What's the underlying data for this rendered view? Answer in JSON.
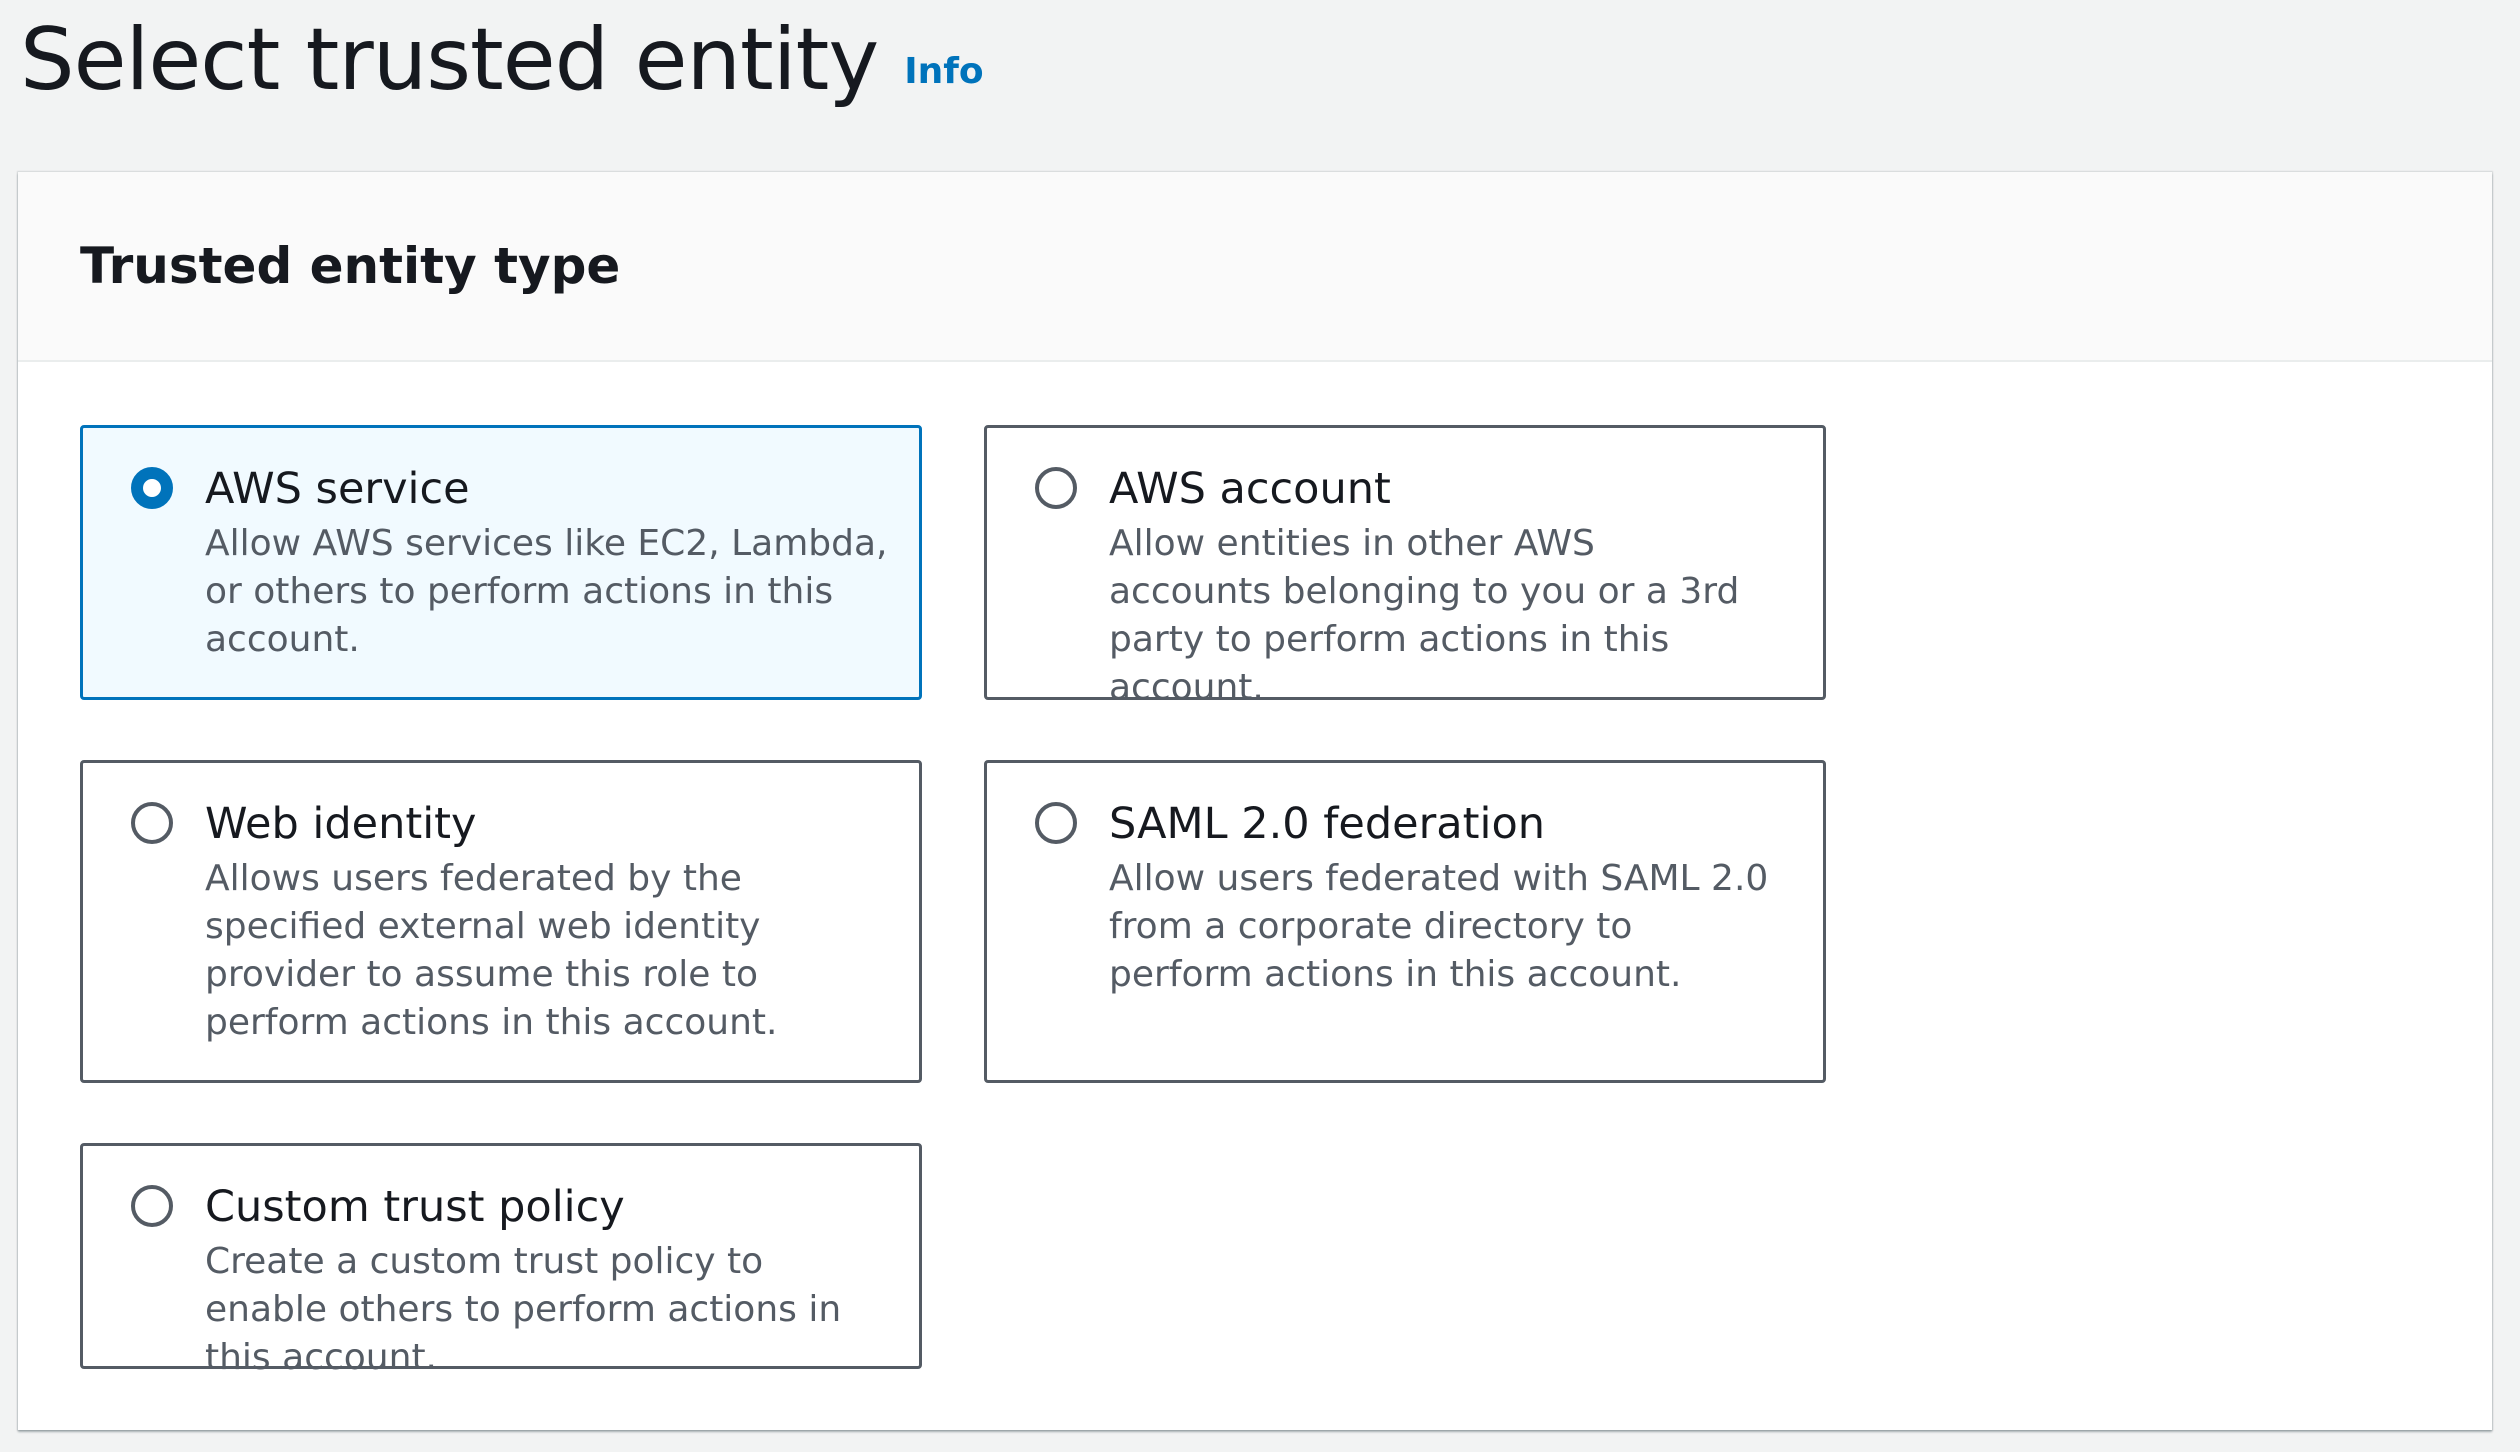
{
  "header": {
    "title": "Select trusted entity",
    "info_label": "Info"
  },
  "section": {
    "title": "Trusted entity type"
  },
  "options": [
    {
      "label": "AWS service",
      "description": "Allow AWS services like EC2, Lambda, or others to perform actions in this account.",
      "selected": true
    },
    {
      "label": "AWS account",
      "description": "Allow entities in other AWS accounts belonging to you or a 3rd party to perform actions in this account.",
      "selected": false
    },
    {
      "label": "Web identity",
      "description": "Allows users federated by the specified external web identity provider to assume this role to perform actions in this account.",
      "selected": false
    },
    {
      "label": "SAML 2.0 federation",
      "description": "Allow users federated with SAML 2.0 from a corporate directory to perform actions in this account.",
      "selected": false
    },
    {
      "label": "Custom trust policy",
      "description": "Create a custom trust policy to enable others to perform actions in this account.",
      "selected": false
    }
  ],
  "colors": {
    "accent": "#0073bb",
    "selected_background": "#f1faff",
    "border": "#545b64",
    "page_background": "#f2f3f3"
  }
}
